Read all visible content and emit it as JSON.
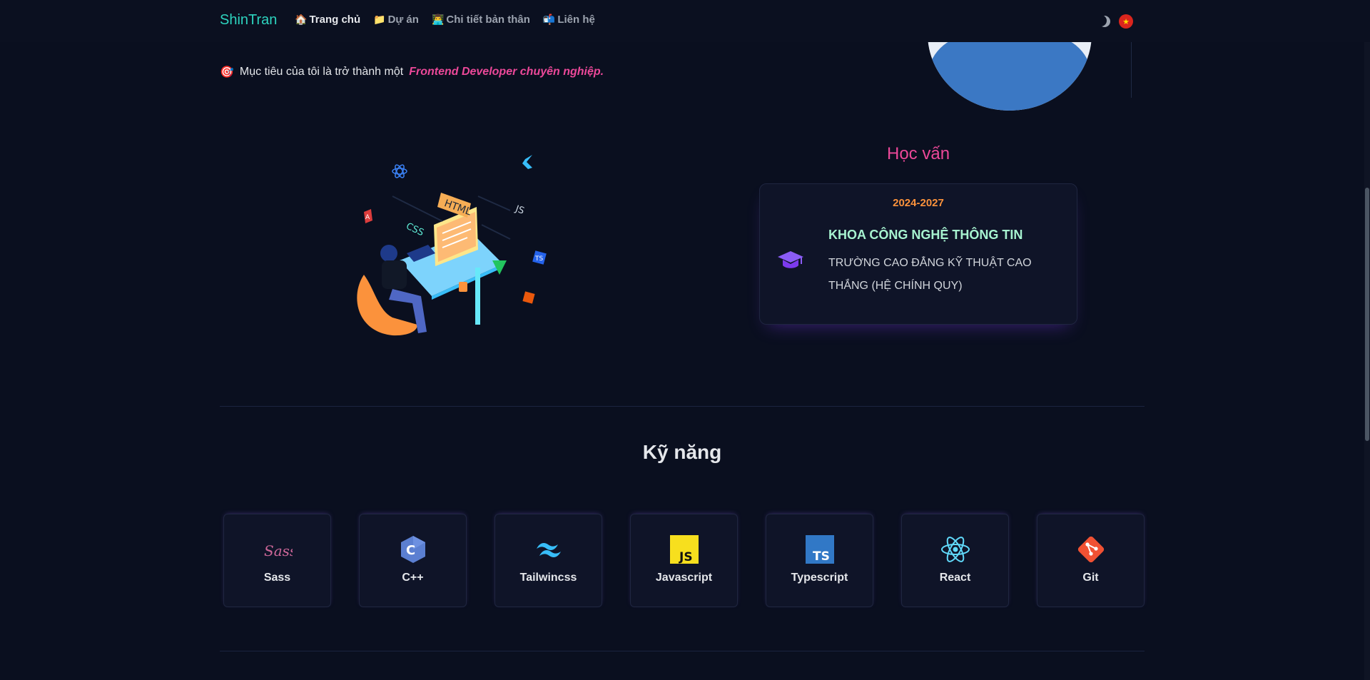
{
  "nav": {
    "brand": "ShinTran",
    "links": [
      {
        "icon": "🏠",
        "label": "Trang chủ"
      },
      {
        "icon": "📁",
        "label": "Dự án"
      },
      {
        "icon": "👨‍💻",
        "label": "Chi tiết bản thân"
      },
      {
        "icon": "📬",
        "label": "Liên hệ"
      }
    ],
    "flag_icon": "★"
  },
  "about": {
    "goal_icon": "🎯",
    "goal_text": "Mục tiêu của tôi là trở thành một",
    "goal_highlight": "Frontend Developer chuyên nghiệp."
  },
  "education": {
    "title": "Học vấn",
    "year": "2024-2027",
    "faculty": "KHOA CÔNG NGHỆ THÔNG TIN",
    "school": "TRƯỜNG CAO ĐẲNG KỸ THUẬT CAO THẮNG (HỆ CHÍNH QUY)"
  },
  "illustration": {
    "html_label": "HTML",
    "css_label": "CSS",
    "js_label": "JS",
    "ts_label": "TS",
    "angular_label": "A"
  },
  "skills": {
    "title": "Kỹ năng",
    "items": [
      {
        "name": "Sass",
        "icon": "sass-icon"
      },
      {
        "name": "C++",
        "icon": "cpp-icon"
      },
      {
        "name": "Tailwincss",
        "icon": "tailwind-icon"
      },
      {
        "name": "Javascript",
        "icon": "javascript-icon"
      },
      {
        "name": "Typescript",
        "icon": "typescript-icon"
      },
      {
        "name": "React",
        "icon": "react-icon"
      },
      {
        "name": "Git",
        "icon": "git-icon"
      }
    ],
    "icon_text": {
      "sass": "Sass",
      "cpp": "C",
      "js": "JS",
      "ts": "TS"
    }
  },
  "colors": {
    "accent_pink": "#ec4899",
    "accent_teal": "#2dd4bf",
    "accent_orange": "#fb923c",
    "background": "#0a0f1f"
  }
}
